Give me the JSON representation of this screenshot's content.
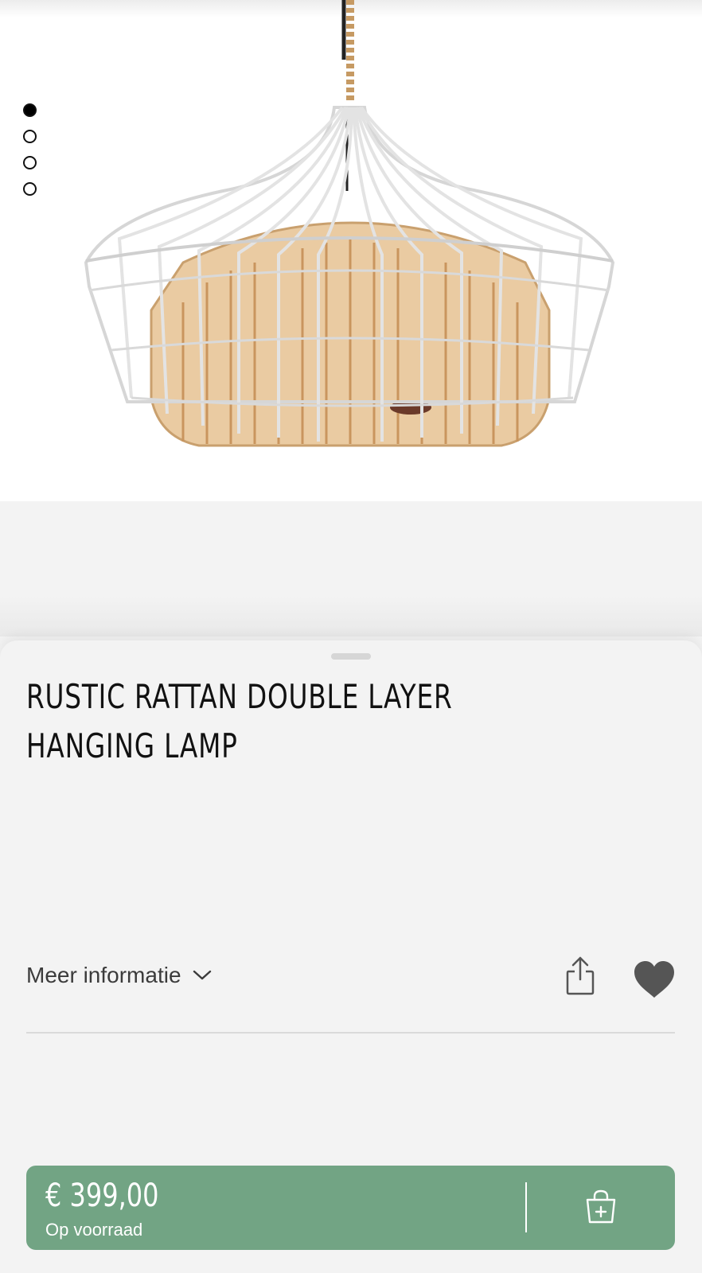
{
  "gallery": {
    "image_alt": "",
    "slide_count": 4,
    "active_slide": 1
  },
  "product": {
    "title_line1": "RUSTIC RATTAN DOUBLE LAYER",
    "title_line2": "HANGING LAMP",
    "more_info_label": "Meer informatie",
    "price": "€ 399,00",
    "stock_status": "Op voorraad"
  },
  "colors": {
    "accent": "#72a484",
    "background": "#f3f3f3",
    "heart": "#555555"
  },
  "icons": {
    "expand": "chevron-down-icon",
    "share": "share-icon",
    "favorite": "heart-icon",
    "cart": "shopping-bag-plus-icon"
  }
}
